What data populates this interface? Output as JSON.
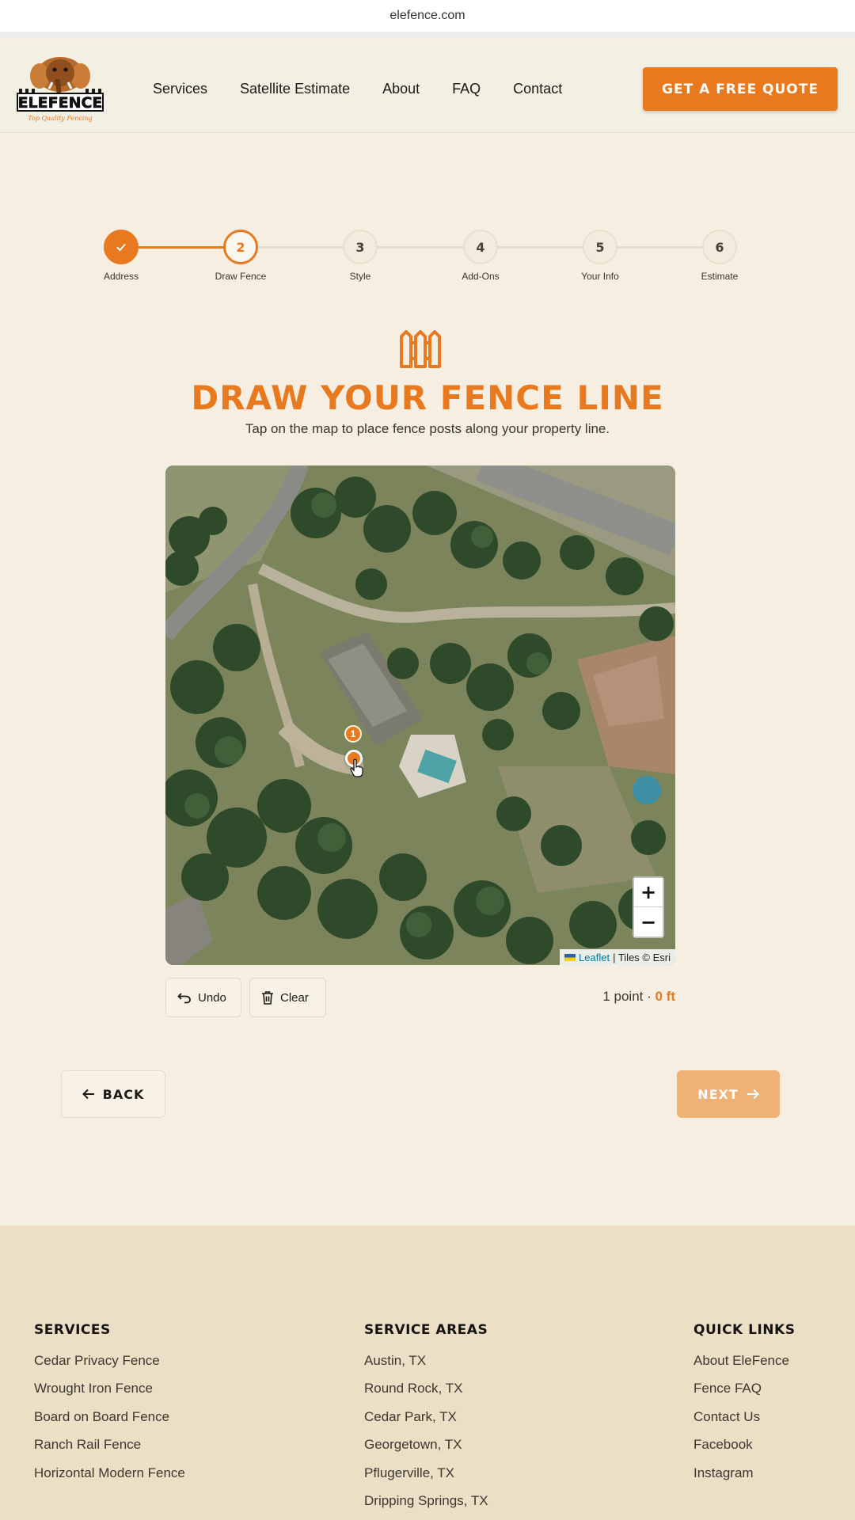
{
  "browser": {
    "url": "elefence.com"
  },
  "header": {
    "logo_text": "ELEFENCE",
    "logo_tagline": "Top Quality Fencing",
    "nav": [
      "Services",
      "Satellite Estimate",
      "About",
      "FAQ",
      "Contact"
    ],
    "cta_label": "GET A FREE QUOTE"
  },
  "stepper": {
    "current_step": 2,
    "steps": [
      {
        "number": "1",
        "label": "Address",
        "status": "done"
      },
      {
        "number": "2",
        "label": "Draw Fence",
        "status": "active"
      },
      {
        "number": "3",
        "label": "Style",
        "status": "pending"
      },
      {
        "number": "4",
        "label": "Add-Ons",
        "status": "pending"
      },
      {
        "number": "5",
        "label": "Your Info",
        "status": "pending"
      },
      {
        "number": "6",
        "label": "Estimate",
        "status": "pending"
      }
    ]
  },
  "main": {
    "title": "DRAW YOUR FENCE LINE",
    "subtitle": "Tap on the map to place fence posts along your property line."
  },
  "map": {
    "pin_label": "1",
    "zoom_in": "+",
    "zoom_out": "−",
    "attribution_link": "Leaflet",
    "attribution_text": "| Tiles © Esri"
  },
  "tools": {
    "undo_label": "Undo",
    "clear_label": "Clear",
    "points_text": "1 point · ",
    "length_text": "0 ft"
  },
  "navigation": {
    "back_label": "BACK",
    "next_label": "NEXT"
  },
  "footer": {
    "services": {
      "heading": "SERVICES",
      "items": [
        "Cedar Privacy Fence",
        "Wrought Iron Fence",
        "Board on Board Fence",
        "Ranch Rail Fence",
        "Horizontal Modern Fence"
      ]
    },
    "service_areas": {
      "heading": "SERVICE AREAS",
      "items": [
        "Austin, TX",
        "Round Rock, TX",
        "Cedar Park, TX",
        "Georgetown, TX",
        "Pflugerville, TX",
        "Dripping Springs, TX"
      ]
    },
    "quick_links": {
      "heading": "QUICK LINKS",
      "items": [
        "About EleFence",
        "Fence FAQ",
        "Contact Us",
        "Facebook",
        "Instagram"
      ]
    }
  },
  "colors": {
    "accent": "#e8791f",
    "accent_disabled": "#efb176",
    "page_bg": "#f5eee1",
    "footer_bg": "#ebdfc6"
  }
}
